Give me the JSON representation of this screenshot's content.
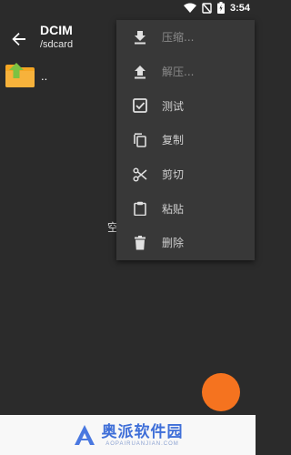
{
  "status_bar": {
    "time": "3:54"
  },
  "header": {
    "title": "DCIM",
    "path": "/sdcard"
  },
  "list": {
    "parent_label": ".."
  },
  "empty_text": "空",
  "menu": {
    "items": [
      {
        "label": "压缩...",
        "icon": "download-icon",
        "enabled": false
      },
      {
        "label": "解压...",
        "icon": "upload-icon",
        "enabled": false
      },
      {
        "label": "测试",
        "icon": "checkbox-icon",
        "enabled": true
      },
      {
        "label": "复制",
        "icon": "copy-icon",
        "enabled": true
      },
      {
        "label": "剪切",
        "icon": "scissors-icon",
        "enabled": true
      },
      {
        "label": "粘贴",
        "icon": "clipboard-icon",
        "enabled": true
      },
      {
        "label": "删除",
        "icon": "delete-icon",
        "enabled": true
      }
    ]
  },
  "watermark": {
    "main": "奥派软件园",
    "sub": "AOPAIRUANJIAN.COM"
  },
  "colors": {
    "background": "#2b2b2b",
    "menu_bg": "#383838",
    "fab": "#f5731f",
    "folder": "#f5a623",
    "arrow": "#7cc242"
  }
}
